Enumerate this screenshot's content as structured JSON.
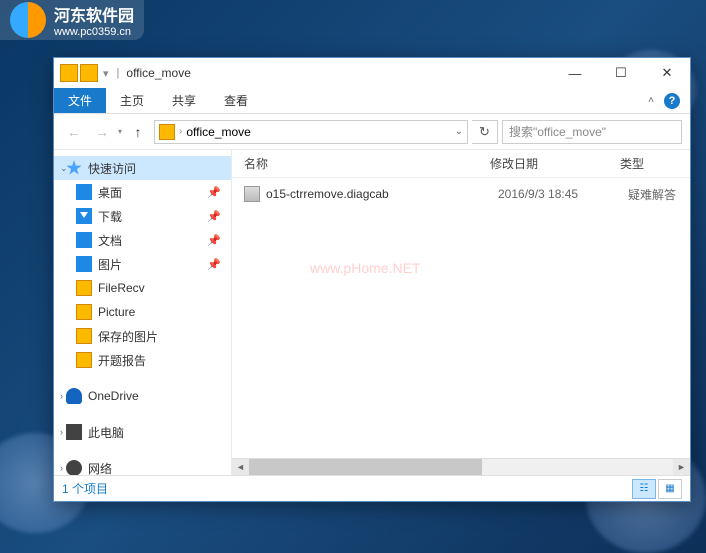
{
  "watermark": {
    "title": "河东软件园",
    "url": "www.pc0359.cn",
    "center": "www.pHome.NET"
  },
  "window": {
    "title": "office_move",
    "controls": {
      "min": "—",
      "max": "☐",
      "close": "✕"
    }
  },
  "ribbon": {
    "file": "文件",
    "home": "主页",
    "share": "共享",
    "view": "查看",
    "help": "?"
  },
  "nav": {
    "back": "←",
    "forward": "→",
    "up": "↑",
    "path": "office_move",
    "refresh": "↻",
    "search_placeholder": "搜索\"office_move\""
  },
  "sidebar": {
    "quick": "快速访问",
    "desktop": "桌面",
    "downloads": "下载",
    "documents": "文档",
    "pictures": "图片",
    "filerecv": "FileRecv",
    "picture_en": "Picture",
    "saved_pics": "保存的图片",
    "report": "开题报告",
    "onedrive": "OneDrive",
    "thispc": "此电脑",
    "network": "网络"
  },
  "headers": {
    "name": "名称",
    "date": "修改日期",
    "type": "类型"
  },
  "files": [
    {
      "name": "o15-ctrremove.diagcab",
      "date": "2016/9/3 18:45",
      "type": "疑难解答"
    }
  ],
  "status": {
    "count": "1 个项目"
  }
}
